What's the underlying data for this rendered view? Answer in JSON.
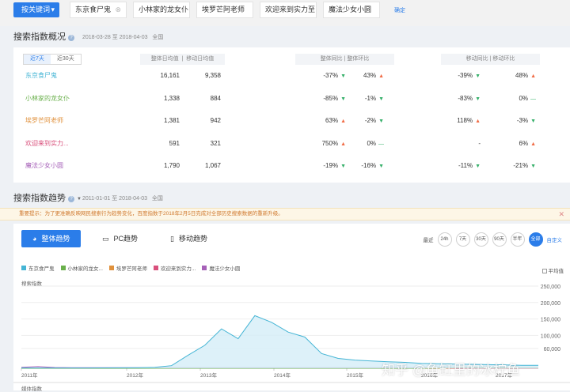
{
  "topbar": {
    "compare_button": "按关键词",
    "keywords": [
      "东京食尸鬼",
      "小林家的龙女仆",
      "埃罗芒阿老师",
      "欢迎来到实力至",
      "魔法少女小圆"
    ],
    "confirm": "确定"
  },
  "overview": {
    "title": "搜索指数概况",
    "date_range": "2018-03-28 至 2018-04-03",
    "region": "全国",
    "period_tabs": [
      "近7天",
      "近30天"
    ],
    "headers": {
      "total_avg": "整体日均值",
      "mobile_avg": "移动日均值",
      "total_ratio": "整体同比 | 整体环比",
      "mobile_ratio": "移动同比 | 移动环比"
    },
    "rows": [
      {
        "name": "东京食尸鬼",
        "color": "#45b5d5",
        "total_avg": "16,161",
        "mobile_avg": "9,358",
        "t_yoy": "-37%",
        "t_yoy_dir": "down",
        "t_mom": "43%",
        "t_mom_dir": "up",
        "m_yoy": "-39%",
        "m_yoy_dir": "down",
        "m_mom": "48%",
        "m_mom_dir": "up"
      },
      {
        "name": "小林家的龙女仆",
        "color": "#6ab04c",
        "total_avg": "1,338",
        "mobile_avg": "884",
        "t_yoy": "-85%",
        "t_yoy_dir": "down",
        "t_mom": "-1%",
        "t_mom_dir": "down",
        "m_yoy": "-83%",
        "m_yoy_dir": "down",
        "m_mom": "0%",
        "m_mom_dir": "flat"
      },
      {
        "name": "埃罗芒阿老师",
        "color": "#e0913c",
        "total_avg": "1,381",
        "mobile_avg": "942",
        "t_yoy": "63%",
        "t_yoy_dir": "up",
        "t_mom": "-2%",
        "t_mom_dir": "down",
        "m_yoy": "118%",
        "m_yoy_dir": "up",
        "m_mom": "-3%",
        "m_mom_dir": "down"
      },
      {
        "name": "欢迎来到实力...",
        "color": "#d9507c",
        "total_avg": "591",
        "mobile_avg": "321",
        "t_yoy": "750%",
        "t_yoy_dir": "up",
        "t_mom": "0%",
        "t_mom_dir": "flat",
        "m_yoy": "-",
        "m_yoy_dir": "none",
        "m_mom": "6%",
        "m_mom_dir": "up"
      },
      {
        "name": "魔法少女小圆",
        "color": "#a661b8",
        "total_avg": "1,790",
        "mobile_avg": "1,067",
        "t_yoy": "-19%",
        "t_yoy_dir": "down",
        "t_mom": "-16%",
        "t_mom_dir": "down",
        "m_yoy": "-11%",
        "m_yoy_dir": "down",
        "m_mom": "-21%",
        "m_mom_dir": "down"
      }
    ]
  },
  "trend": {
    "title": "搜索指数趋势",
    "date_range": "2011-01-01 至 2018-04-03",
    "region": "全国",
    "notice": "重要提示：为了更准确反映网民搜索行为趋势变化，百度指数于2018年2月5日完成对全部历史搜索数据的重新升级。",
    "tabs": [
      "整体趋势",
      "PC趋势",
      "移动趋势"
    ],
    "range_label": "最近",
    "ranges": [
      "24h",
      "7天",
      "30天",
      "90天",
      "半年",
      "全部"
    ],
    "active_range": "全部",
    "custom": "自定义",
    "avg_label": "平均值",
    "y_title": "搜索指数",
    "y_title_bottom": "媒体指数",
    "legend": [
      {
        "name": "东京食尸鬼",
        "color": "#45b5d5"
      },
      {
        "name": "小林家的龙女...",
        "color": "#6ab04c"
      },
      {
        "name": "埃罗芒阿老师",
        "color": "#e0913c"
      },
      {
        "name": "欢迎来到实力...",
        "color": "#d9507c"
      },
      {
        "name": "魔法少女小圆",
        "color": "#a661b8"
      }
    ]
  },
  "chart_data": {
    "type": "area",
    "ylabel": "搜索指数",
    "ylim": [
      0,
      250000
    ],
    "y_ticks": [
      "250,000",
      "200,000",
      "150,000",
      "100,000",
      "60,000"
    ],
    "x_ticks": [
      "2011年",
      "2012年",
      "2013年",
      "2014年",
      "2015年",
      "2016年",
      "2017年"
    ],
    "series": [
      {
        "name": "东京食尸鬼",
        "values": [
          1000,
          1000,
          1000,
          1000,
          1000,
          1200,
          1500,
          2000,
          3000,
          8000,
          40000,
          70000,
          120000,
          90000,
          160000,
          140000,
          110000,
          95000,
          45000,
          30000,
          25000,
          22000,
          20000,
          18000,
          15000,
          14000,
          13000,
          12000,
          11000,
          10000,
          9000,
          9000
        ]
      },
      {
        "name": "小林家的龙女仆",
        "values": [
          0,
          0,
          0,
          0,
          0,
          0,
          0,
          0,
          0,
          0,
          0,
          0,
          0,
          0,
          0,
          0,
          0,
          0,
          0,
          0,
          0,
          0,
          0,
          0,
          0,
          1000,
          1500,
          2000,
          1500,
          1500,
          1300,
          1300
        ]
      },
      {
        "name": "埃罗芒阿老师",
        "values": [
          0,
          0,
          0,
          0,
          0,
          0,
          0,
          0,
          0,
          0,
          0,
          0,
          0,
          0,
          0,
          0,
          0,
          0,
          0,
          0,
          0,
          0,
          0,
          0,
          0,
          0,
          1000,
          2500,
          1500,
          1400,
          1400,
          1400
        ]
      },
      {
        "name": "欢迎来到实力...",
        "values": [
          0,
          0,
          0,
          0,
          0,
          0,
          0,
          0,
          0,
          0,
          0,
          0,
          0,
          0,
          0,
          0,
          0,
          0,
          0,
          0,
          0,
          0,
          0,
          0,
          0,
          0,
          0,
          500,
          600,
          600,
          600,
          600
        ]
      },
      {
        "name": "魔法少女小圆",
        "values": [
          3000,
          5000,
          2500,
          2000,
          2000,
          2000,
          2000,
          2000,
          2000,
          2000,
          2000,
          2000,
          2000,
          2000,
          2000,
          2000,
          2000,
          2000,
          2000,
          2000,
          2000,
          2000,
          2000,
          2000,
          2000,
          2000,
          2000,
          2000,
          2000,
          1800,
          1800,
          1800
        ]
      }
    ]
  },
  "watermark": "知乎 @鱼缸里的冰柠鱼"
}
